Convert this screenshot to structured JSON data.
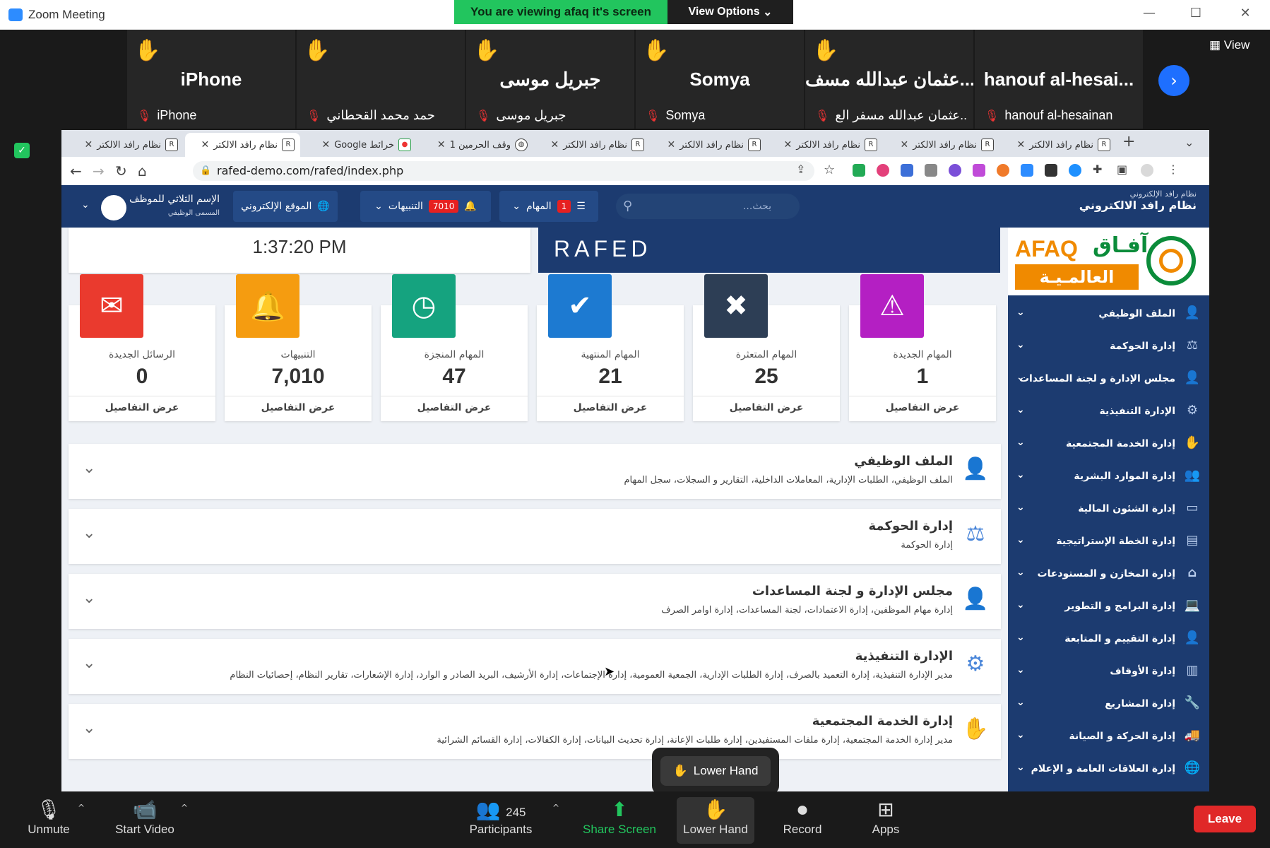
{
  "zoom": {
    "window_title": "Zoom Meeting",
    "share_banner": "You are viewing afaq it's screen",
    "view_options": "View Options",
    "view_label": "View",
    "participants_tiles": [
      {
        "big": "iPhone",
        "small": "iPhone"
      },
      {
        "big": "",
        "small": "حمد محمد القحطاني"
      },
      {
        "big": "جبريل موسى",
        "small": "جبريل موسى"
      },
      {
        "big": "Somya",
        "small": "Somya"
      },
      {
        "big": "عثمان عبدالله مسف...",
        "small": "عثمان عبدالله مسفر الع..."
      },
      {
        "big": "hanouf al-hesai...",
        "small": "hanouf al-hesainan"
      }
    ],
    "popup_lower_hand": "Lower Hand",
    "toolbar": {
      "unmute": "Unmute",
      "start_video": "Start Video",
      "participants": "Participants",
      "participants_count": "245",
      "share_screen": "Share Screen",
      "lower_hand": "Lower Hand",
      "record": "Record",
      "apps": "Apps",
      "leave": "Leave"
    }
  },
  "browser": {
    "tabs": [
      {
        "title": "نظام رافد الالكتر"
      },
      {
        "title": "نظام رافد الالكتر"
      },
      {
        "title": "خرائط Google"
      },
      {
        "title": "وقف الحرمين 1"
      },
      {
        "title": "نظام رافد الالكتر"
      },
      {
        "title": "نظام رافد الالكتر"
      },
      {
        "title": "نظام رافد الالكتر"
      },
      {
        "title": "نظام رافد الالكتر"
      },
      {
        "title": "نظام رافد الالكتر"
      }
    ],
    "url": "rafed-demo.com/rafed/index.php"
  },
  "app": {
    "brand_small": "نظام رافد الإلكتروني",
    "brand_title": "نظام رافد الالكتروني",
    "search_placeholder": "بحث...",
    "tasks_label": "المهام",
    "tasks_badge": "1",
    "alerts_label": "التنبيهات",
    "alerts_badge": "7010",
    "website_label": "الموقع الإلكتروني",
    "user_name": "الإسم الثلاثي للموظف",
    "user_title": "المسمى الوظيفي",
    "clock": "1:37:20 PM",
    "rafed_logo": "RAFED",
    "logo_en": "AFAQ",
    "logo_ar": "آفـاق",
    "logo_ar2": "العالمـيـة",
    "stats": [
      {
        "label": "الرسائل الجديدة",
        "value": "0",
        "details": "عرض التفاصيل",
        "color": "#ea3a2e",
        "icon": "envelope-icon"
      },
      {
        "label": "التنبيهات",
        "value": "7,010",
        "details": "عرض التفاصيل",
        "color": "#f59c10",
        "icon": "bell-icon"
      },
      {
        "label": "المهام المنجزة",
        "value": "47",
        "details": "عرض التفاصيل",
        "color": "#15a37f",
        "icon": "clock-icon"
      },
      {
        "label": "المهام المنتهية",
        "value": "21",
        "details": "عرض التفاصيل",
        "color": "#1d7ad1",
        "icon": "check-icon"
      },
      {
        "label": "المهام المتعثرة",
        "value": "25",
        "details": "عرض التفاصيل",
        "color": "#2d3e55",
        "icon": "x-icon"
      },
      {
        "label": "المهام الجديدة",
        "value": "1",
        "details": "عرض التفاصيل",
        "color": "#b41fc3",
        "icon": "warning-icon"
      }
    ],
    "sections": [
      {
        "title": "الملف الوظيفي",
        "desc": "الملف الوظيفي، الطلبات الإدارية، المعاملات الداخلية، التقارير و السجلات، سجل المهام"
      },
      {
        "title": "إدارة الحوكمة",
        "desc": "إدارة الحوكمة"
      },
      {
        "title": "مجلس الإدارة و لجنة المساعدات",
        "desc": "إدارة مهام الموظفين، إدارة الاعتمادات، لجنة المساعدات، إدارة اوامر الصرف"
      },
      {
        "title": "الإدارة التنفيذية",
        "desc": "مدير الإدارة التنفيذية، إدارة التعميد بالصرف، إدارة الطلبات الإدارية، الجمعية العمومية، إدارة الإجتماعات، إدارة الأرشيف، البريد الصادر و الوارد، إدارة الإشعارات، تقارير النظام، إحصائيات النظام"
      },
      {
        "title": "إدارة الخدمة المجتمعية",
        "desc": "مدير إدارة الخدمة المجتمعية، إدارة ملفات المستفيدين، إدارة طلبات الإعانة، إدارة تحديث البيانات، إدارة الكفالات، إدارة القسائم الشرائية"
      }
    ],
    "sidebar": [
      "الملف الوظيفي",
      "إدارة الحوكمة",
      "مجلس الإدارة و لجنة المساعدات",
      "الإدارة التنفيذية",
      "إدارة الخدمة المجتمعية",
      "إدارة الموارد البشرية",
      "إدارة الشئون المالية",
      "إدارة الخطة الإستراتيجية",
      "إدارة المخازن و المستودعات",
      "إدارة البرامج و التطوير",
      "إدارة التقييم و المتابعة",
      "إدارة الأوقاف",
      "إدارة المشاريع",
      "إدارة الحركة و الصيانة",
      "إدارة العلاقات العامة و الإعلام"
    ]
  }
}
